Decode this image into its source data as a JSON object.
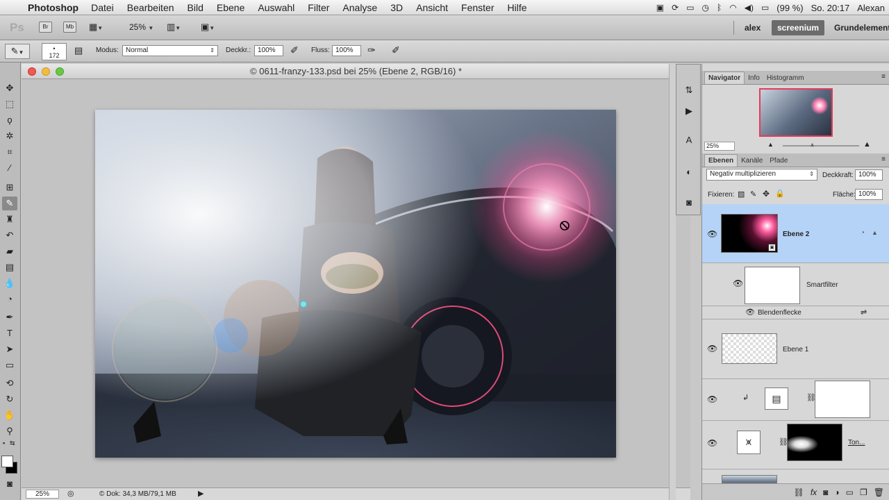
{
  "menubar": {
    "app_name": "Photoshop",
    "items": [
      "Datei",
      "Bearbeiten",
      "Bild",
      "Ebene",
      "Auswahl",
      "Filter",
      "Analyse",
      "3D",
      "Ansicht",
      "Fenster",
      "Hilfe"
    ],
    "battery": "(99 %)",
    "clock": "So. 20:17",
    "user": "Alexan"
  },
  "appbar": {
    "logo": "Ps",
    "br_label": "Br",
    "mb_label": "Mb",
    "zoom": "25%",
    "workspaces": [
      "alex",
      "screenium",
      "Grundelement"
    ]
  },
  "options": {
    "brush_size": "172",
    "modus_label": "Modus:",
    "modus_value": "Normal",
    "deckkr_label": "Deckkr.:",
    "deckkr_value": "100%",
    "fluss_label": "Fluss:",
    "fluss_value": "100%"
  },
  "document": {
    "title": "© 0611-franzy-133.psd bei 25% (Ebene 2, RGB/16) *",
    "status_zoom": "25%",
    "status_doc": "© Dok: 34,3 MB/79,1 MB"
  },
  "navigator": {
    "tabs": [
      "Navigator",
      "Info",
      "Histogramm"
    ],
    "zoom": "25%"
  },
  "layers_panel": {
    "tabs": [
      "Ebenen",
      "Kanäle",
      "Pfade"
    ],
    "blend_mode": "Negativ multiplizieren",
    "opacity_label": "Deckkraft:",
    "opacity_value": "100%",
    "lock_label": "Fixieren:",
    "fill_label": "Fläche:",
    "fill_value": "100%",
    "layers": [
      {
        "name": "Ebene 2"
      },
      {
        "name": "Smartfilter"
      },
      {
        "name": "Blendenflecke"
      },
      {
        "name": "Ebene 1"
      },
      {
        "name": ""
      },
      {
        "name": "Ton..."
      }
    ]
  },
  "colors": {
    "selection": "#b5d3f7",
    "flare": "#ff6fa8"
  }
}
